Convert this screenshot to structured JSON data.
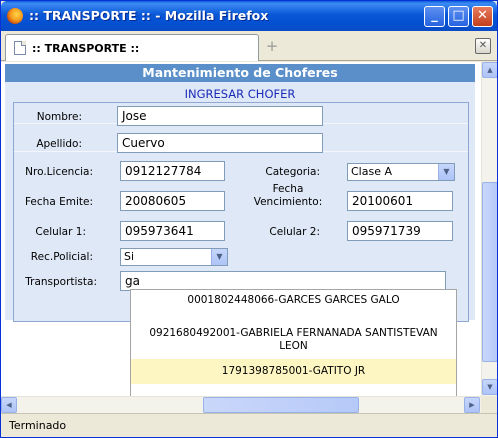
{
  "window": {
    "title": ":: TRANSPORTE :: - Mozilla Firefox",
    "min_glyph": "_",
    "max_glyph": "□",
    "close_glyph": "✕"
  },
  "tabs": [
    {
      "label": ":: TRANSPORTE ::"
    }
  ],
  "newtab_glyph": "+",
  "tab_close_glyph": "✕",
  "page": {
    "header": "Mantenimiento de Choferes",
    "subtitle": "INGRESAR CHOFER"
  },
  "form": {
    "nombre": {
      "label": "Nombre:",
      "value": "Jose"
    },
    "apellido": {
      "label": "Apellido:",
      "value": "Cuervo"
    },
    "licencia": {
      "label": "Nro.Licencia:",
      "value": "0912127784"
    },
    "categoria": {
      "label": "Categoria:",
      "value": "Clase A"
    },
    "fecha_emite": {
      "label": "Fecha Emite:",
      "value": "20080605"
    },
    "fecha_venc": {
      "label_line1": "Fecha",
      "label_line2": "Vencimiento:",
      "value": "20100601"
    },
    "celular1": {
      "label": "Celular 1:",
      "value": "095973641"
    },
    "celular2": {
      "label": "Celular 2:",
      "value": "095971739"
    },
    "rec_policial": {
      "label": "Rec.Policial:",
      "value": "Si"
    },
    "transportista": {
      "label": "Transportista:",
      "value": "ga"
    }
  },
  "suggestions": [
    {
      "text": "0001802448066-GARCES GARCES GALO",
      "active": false
    },
    {
      "text": "0921680492001-GABRIELA FERNANADA SANTISTEVAN LEON",
      "active": false
    },
    {
      "text": "1791398785001-GATITO JR",
      "active": true
    }
  ],
  "status": {
    "text": "Terminado"
  },
  "colors": {
    "header_bg": "#5b8fca",
    "form_bg": "#dfe8f6",
    "subtitle": "#1a2bb8",
    "suggest_active": "#fdf6c3",
    "titlebar": "#0a58d6"
  }
}
